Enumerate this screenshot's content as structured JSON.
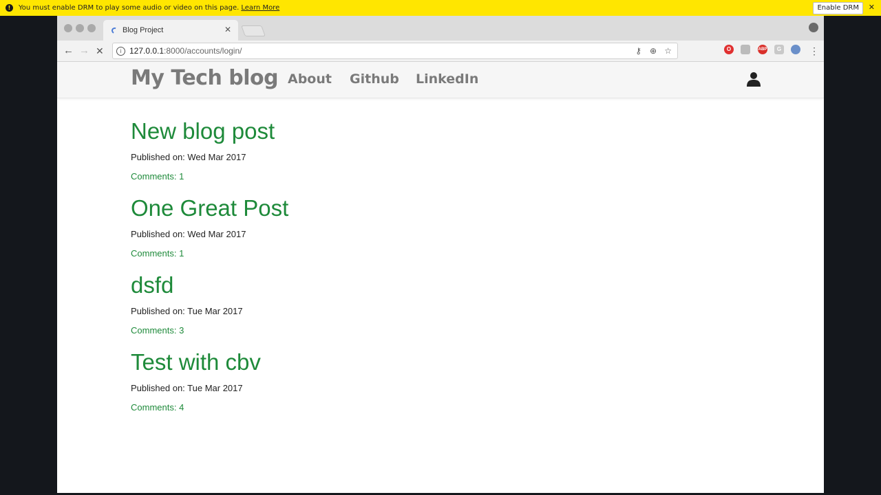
{
  "drm_bar": {
    "message": "You must enable DRM to play some audio or video on this page.",
    "learn_more": "Learn More",
    "enable_button": "Enable DRM",
    "close": "✕"
  },
  "browser": {
    "tab_title": "Blog Project",
    "tab_close": "✕",
    "url_host": "127.0.0.1",
    "url_path": ":8000/accounts/login/"
  },
  "site": {
    "brand": "My Tech blog",
    "nav": [
      "About",
      "Github",
      "LinkedIn"
    ]
  },
  "posts": [
    {
      "title": "New blog post",
      "date": "Published on: Wed Mar 2017",
      "comments": "Comments: 1"
    },
    {
      "title": "One Great Post",
      "date": "Published on: Wed Mar 2017",
      "comments": "Comments: 1"
    },
    {
      "title": "dsfd",
      "date": "Published on: Tue Mar 2017",
      "comments": "Comments: 3"
    },
    {
      "title": "Test with cbv",
      "date": "Published on: Tue Mar 2017",
      "comments": "Comments: 4"
    }
  ],
  "colors": {
    "accent_green": "#1e8a3a",
    "drm_yellow": "#ffe600",
    "nav_gray": "#7a7a7a"
  }
}
